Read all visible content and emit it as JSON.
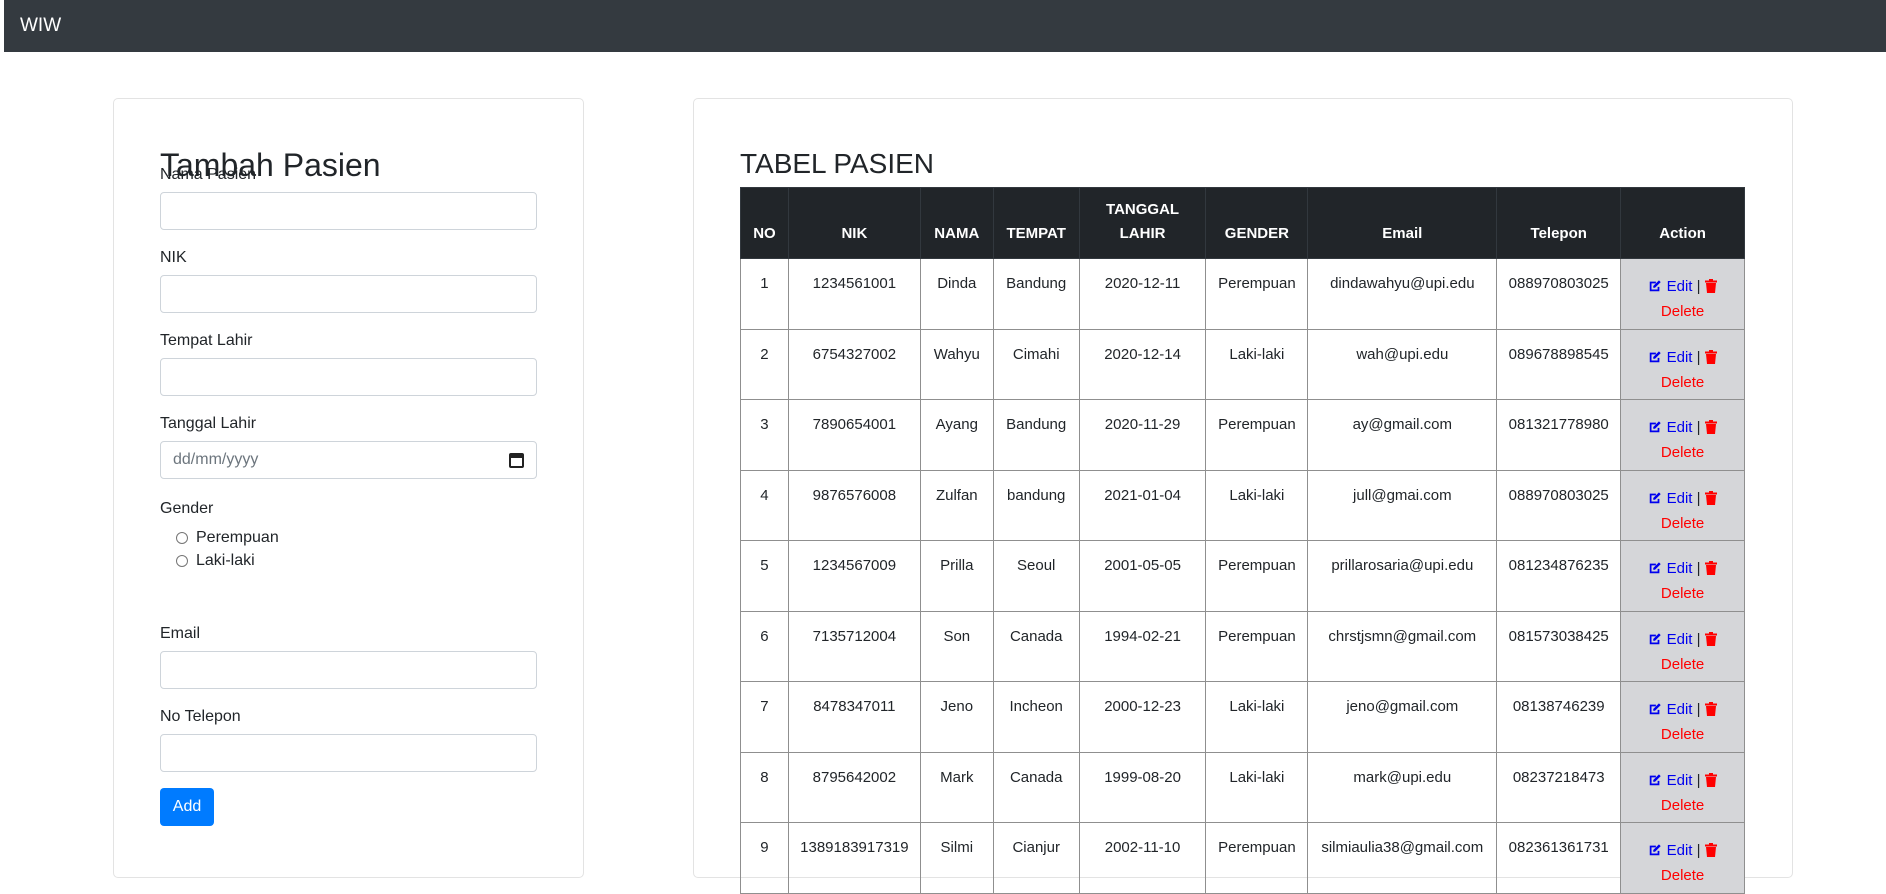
{
  "navbar": {
    "brand": "WIW"
  },
  "form": {
    "title": "Tambah Pasien",
    "fields": {
      "nama": {
        "label": "Nama Pasien",
        "value": ""
      },
      "nik": {
        "label": "NIK",
        "value": ""
      },
      "tempat": {
        "label": "Tempat Lahir",
        "value": ""
      },
      "tanggal": {
        "label": "Tanggal Lahir",
        "placeholder": "dd/mm/yyyy"
      },
      "gender": {
        "label": "Gender",
        "options": [
          "Perempuan",
          "Laki-laki"
        ]
      },
      "email": {
        "label": "Email",
        "value": ""
      },
      "telepon": {
        "label": "No Telepon",
        "value": ""
      }
    },
    "add_label": "Add"
  },
  "table": {
    "title": "TABEL PASIEN",
    "headers": [
      "NO",
      "NIK",
      "NAMA",
      "TEMPAT",
      "TANGGAL LAHIR",
      "GENDER",
      "Email",
      "Telepon",
      "Action"
    ],
    "edit_label": "Edit",
    "separator": "|",
    "delete_label": "Delete",
    "rows": [
      [
        "1",
        "1234561001",
        "Dinda",
        "Bandung",
        "2020-12-11",
        "Perempuan",
        "dindawahyu@upi.edu",
        "088970803025"
      ],
      [
        "2",
        "6754327002",
        "Wahyu",
        "Cimahi",
        "2020-12-14",
        "Laki-laki",
        "wah@upi.edu",
        "089678898545"
      ],
      [
        "3",
        "7890654001",
        "Ayang",
        "Bandung",
        "2020-11-29",
        "Perempuan",
        "ay@gmail.com",
        "081321778980"
      ],
      [
        "4",
        "9876576008",
        "Zulfan",
        "bandung",
        "2021-01-04",
        "Laki-laki",
        "jull@gmai.com",
        "088970803025"
      ],
      [
        "5",
        "1234567009",
        "Prilla",
        "Seoul",
        "2001-05-05",
        "Perempuan",
        "prillarosaria@upi.edu",
        "081234876235"
      ],
      [
        "6",
        "7135712004",
        "Son",
        "Canada",
        "1994-02-21",
        "Perempuan",
        "chrstjsmn@gmail.com",
        "081573038425"
      ],
      [
        "7",
        "8478347011",
        "Jeno",
        "Incheon",
        "2000-12-23",
        "Laki-laki",
        "jeno@gmail.com",
        "08138746239"
      ],
      [
        "8",
        "8795642002",
        "Mark",
        "Canada",
        "1999-08-20",
        "Laki-laki",
        "mark@upi.edu",
        "08237218473"
      ],
      [
        "9",
        "1389183917319",
        "Silmi",
        "Cianjur",
        "2002-11-10",
        "Perempuan",
        "silmiaulia38@gmail.com",
        "082361361731"
      ]
    ]
  },
  "colors": {
    "navbar": "#343a40",
    "primary": "#007bff",
    "edit": "#0000ee",
    "delete": "#ff0000",
    "action_bg": "#d5d6d9"
  },
  "icons": {
    "edit": "edit-icon",
    "delete": "trash-icon",
    "date": "calendar-icon"
  }
}
